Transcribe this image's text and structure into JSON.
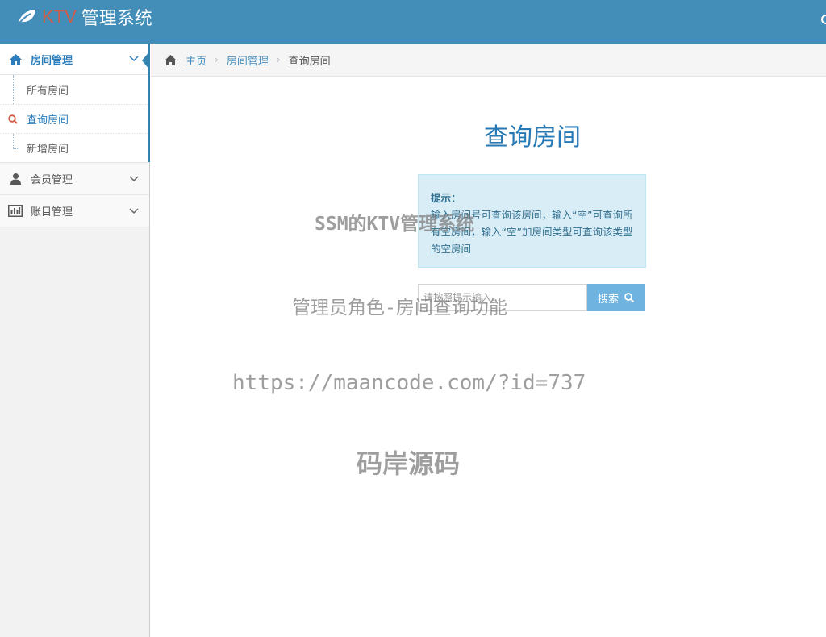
{
  "navbar": {
    "brand_ktv": "KTV",
    "brand_title": "管理系统",
    "brand_icon": "leaf-icon"
  },
  "sidebar": {
    "menus": [
      {
        "label": "房间管理",
        "icon": "home-icon",
        "open": true,
        "items": [
          {
            "label": "所有房间"
          },
          {
            "label": "查询房间",
            "active": true,
            "icon": "search-icon"
          },
          {
            "label": "新增房间"
          }
        ]
      },
      {
        "label": "会员管理",
        "icon": "user-icon"
      },
      {
        "label": "账目管理",
        "icon": "bar-chart-icon"
      }
    ]
  },
  "breadcrumb": {
    "home": "主页",
    "section": "房间管理",
    "current": "查询房间"
  },
  "main": {
    "title": "查询房间",
    "alert": {
      "title": "提示：",
      "text": "输入房间号可查询该房间，输入“空”可查询所有空房间，输入“空”加房间类型可查询该类型的空房间"
    },
    "search": {
      "placeholder": "请按照提示输入...",
      "button_label": "搜索"
    }
  },
  "watermarks": {
    "line1": "SSM的KTV管理系统",
    "line2": "管理员角色-房间查询功能",
    "line3": "https://maancode.com/?id=737",
    "line4": "码岸源码"
  },
  "colors": {
    "navbar": "#438eb9",
    "accent": "#2b7dbc",
    "alert_bg": "#d9edf7",
    "button": "#6fb3e0"
  }
}
